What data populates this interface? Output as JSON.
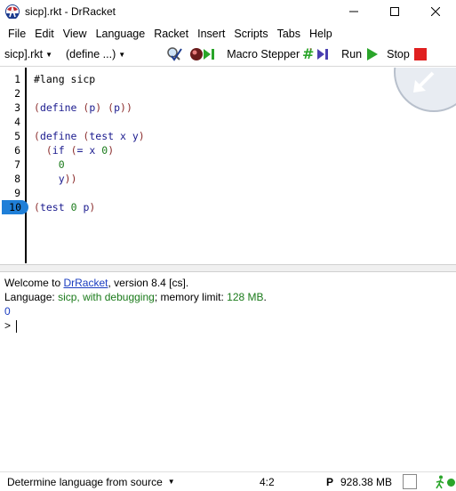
{
  "window": {
    "title": "sicp].rkt - DrRacket"
  },
  "menu": {
    "items": [
      "File",
      "Edit",
      "View",
      "Language",
      "Racket",
      "Insert",
      "Scripts",
      "Tabs",
      "Help"
    ]
  },
  "toolbar": {
    "file_dropdown": "sicp].rkt",
    "define_dropdown": "(define ...)",
    "macro_stepper_label": "Macro Stepper",
    "run_label": "Run",
    "stop_label": "Stop"
  },
  "editor": {
    "line_numbers": [
      "1",
      "2",
      "3",
      "4",
      "5",
      "6",
      "7",
      "8",
      "9",
      "10"
    ],
    "current_line": "10"
  },
  "repl": {
    "welcome_prefix": "Welcome to ",
    "welcome_link": "DrRacket",
    "welcome_suffix": ", version 8.4 [cs].",
    "language_prefix": "Language: ",
    "language_name": "sicp, with debugging",
    "memory_prefix": "; memory limit: ",
    "memory_limit": "128 MB",
    "memory_suffix": ".",
    "output": "0",
    "prompt": ">"
  },
  "status": {
    "language_selector": "Determine language from source",
    "position": "4:2",
    "p_label": "P",
    "memory": "928.38 MB"
  },
  "colors": {
    "current_line_highlight": "#1f7fd8",
    "run_green": "#2aa52a",
    "stop_red": "#e02020",
    "link_blue": "#1a3cc0",
    "repl_green": "#1a7a1a"
  }
}
